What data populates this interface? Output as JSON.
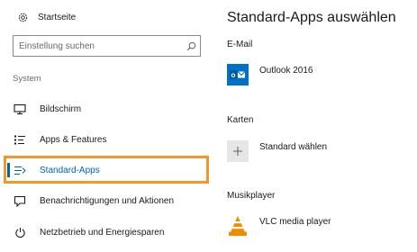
{
  "sidebar": {
    "home_label": "Startseite",
    "search_placeholder": "Einstellung suchen",
    "section_label": "System",
    "items": [
      {
        "label": "Bildschirm",
        "icon": "monitor-icon"
      },
      {
        "label": "Apps & Features",
        "icon": "list-icon"
      },
      {
        "label": "Standard-Apps",
        "icon": "default-apps-icon",
        "active": true
      },
      {
        "label": "Benachrichtigungen und Aktionen",
        "icon": "notification-icon"
      },
      {
        "label": "Netzbetrieb und Energiesparen",
        "icon": "power-icon"
      }
    ]
  },
  "main": {
    "title": "Standard-Apps auswählen",
    "groups": [
      {
        "label": "E-Mail",
        "app": "Outlook 2016",
        "icon": "outlook-icon"
      },
      {
        "label": "Karten",
        "app": "Standard wählen",
        "icon": "plus-icon"
      },
      {
        "label": "Musikplayer",
        "app": "VLC media player",
        "icon": "vlc-icon"
      }
    ]
  },
  "colors": {
    "accent": "#0063b1",
    "highlight_border": "#f0982a",
    "outlook_tile": "#0072c6",
    "placeholder_tile": "#e6e6e6",
    "vlc_orange": "#f08c00"
  }
}
